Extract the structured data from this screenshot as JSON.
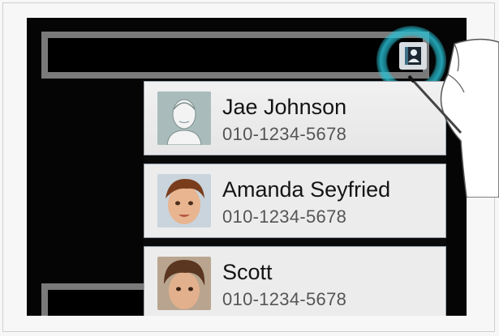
{
  "screen": {
    "contact_button": {
      "icon": "contact-person-icon"
    },
    "contacts": [
      {
        "name": "Jae Johnson",
        "phone": "010-1234-5678",
        "avatar": "default-avatar-icon"
      },
      {
        "name": "Amanda Seyfried",
        "phone": "010-1234-5678",
        "avatar": "child-photo"
      },
      {
        "name": "Scott",
        "phone": "010-1234-5678",
        "avatar": "child-photo"
      }
    ]
  },
  "colors": {
    "tap_highlight": "#28c8dc",
    "list_background": "#ececec",
    "screen_background": "#050505"
  }
}
